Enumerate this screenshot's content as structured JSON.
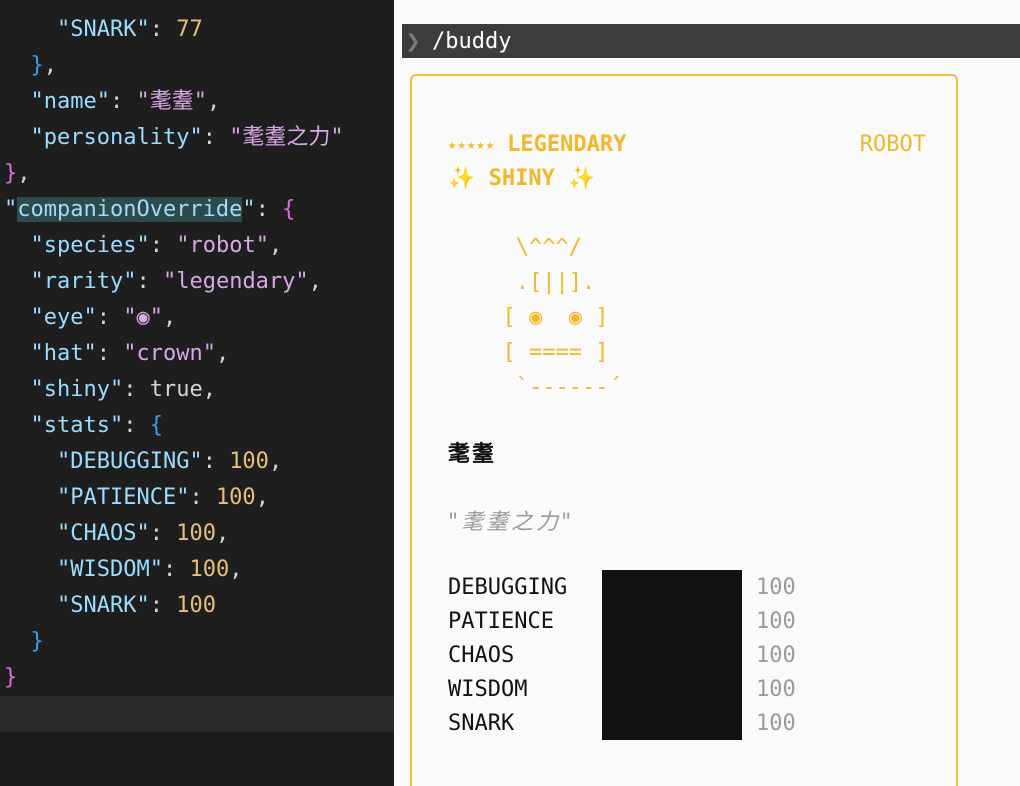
{
  "editor": {
    "lines": [
      {
        "indent": "    ",
        "tokens": [
          {
            "t": "\"SNARK\"",
            "c": "tok-key"
          },
          {
            "t": ": ",
            "c": "tok-punc"
          },
          {
            "t": "77",
            "c": "tok-num2"
          }
        ]
      },
      {
        "indent": "  ",
        "tokens": [
          {
            "t": "}",
            "c": "tok-brace-blue"
          },
          {
            "t": ",",
            "c": "tok-punc"
          }
        ]
      },
      {
        "indent": "  ",
        "tokens": [
          {
            "t": "\"name\"",
            "c": "tok-key"
          },
          {
            "t": ": ",
            "c": "tok-punc"
          },
          {
            "t": "\"耄耋\"",
            "c": "tok-strp"
          },
          {
            "t": ",",
            "c": "tok-punc"
          }
        ]
      },
      {
        "indent": "  ",
        "tokens": [
          {
            "t": "\"personality\"",
            "c": "tok-key"
          },
          {
            "t": ": ",
            "c": "tok-punc"
          },
          {
            "t": "\"耄耋之力\"",
            "c": "tok-strp"
          }
        ]
      },
      {
        "indent": "",
        "tokens": [
          {
            "t": "}",
            "c": "tok-brace-pink"
          },
          {
            "t": ",",
            "c": "tok-punc"
          }
        ]
      },
      {
        "indent": "",
        "tokens": [
          {
            "t": "\"",
            "c": "tok-key"
          },
          {
            "t": "companionOverride",
            "c": "tok-key tok-hl"
          },
          {
            "t": "\"",
            "c": "tok-key"
          },
          {
            "t": ": ",
            "c": "tok-punc"
          },
          {
            "t": "{",
            "c": "tok-brace-pink"
          }
        ]
      },
      {
        "indent": "  ",
        "tokens": [
          {
            "t": "\"species\"",
            "c": "tok-key"
          },
          {
            "t": ": ",
            "c": "tok-punc"
          },
          {
            "t": "\"robot\"",
            "c": "tok-strp"
          },
          {
            "t": ",",
            "c": "tok-punc"
          }
        ]
      },
      {
        "indent": "  ",
        "tokens": [
          {
            "t": "\"rarity\"",
            "c": "tok-key"
          },
          {
            "t": ": ",
            "c": "tok-punc"
          },
          {
            "t": "\"legendary\"",
            "c": "tok-strp"
          },
          {
            "t": ",",
            "c": "tok-punc"
          }
        ]
      },
      {
        "indent": "  ",
        "tokens": [
          {
            "t": "\"eye\"",
            "c": "tok-key"
          },
          {
            "t": ": ",
            "c": "tok-punc"
          },
          {
            "t": "\"◉\"",
            "c": "tok-strp"
          },
          {
            "t": ",",
            "c": "tok-punc"
          }
        ]
      },
      {
        "indent": "  ",
        "tokens": [
          {
            "t": "\"hat\"",
            "c": "tok-key"
          },
          {
            "t": ": ",
            "c": "tok-punc"
          },
          {
            "t": "\"crown\"",
            "c": "tok-strp"
          },
          {
            "t": ",",
            "c": "tok-punc"
          }
        ]
      },
      {
        "indent": "  ",
        "tokens": [
          {
            "t": "\"shiny\"",
            "c": "tok-key"
          },
          {
            "t": ": ",
            "c": "tok-punc"
          },
          {
            "t": "true",
            "c": "tok-bool"
          },
          {
            "t": ",",
            "c": "tok-punc"
          }
        ]
      },
      {
        "indent": "  ",
        "tokens": [
          {
            "t": "\"stats\"",
            "c": "tok-key"
          },
          {
            "t": ": ",
            "c": "tok-punc"
          },
          {
            "t": "{",
            "c": "tok-brace-blue"
          }
        ]
      },
      {
        "indent": "    ",
        "tokens": [
          {
            "t": "\"DEBUGGING\"",
            "c": "tok-key"
          },
          {
            "t": ": ",
            "c": "tok-punc"
          },
          {
            "t": "100",
            "c": "tok-num2"
          },
          {
            "t": ",",
            "c": "tok-punc"
          }
        ]
      },
      {
        "indent": "    ",
        "tokens": [
          {
            "t": "\"PATIENCE\"",
            "c": "tok-key"
          },
          {
            "t": ": ",
            "c": "tok-punc"
          },
          {
            "t": "100",
            "c": "tok-num2"
          },
          {
            "t": ",",
            "c": "tok-punc"
          }
        ]
      },
      {
        "indent": "    ",
        "tokens": [
          {
            "t": "\"CHAOS\"",
            "c": "tok-key"
          },
          {
            "t": ": ",
            "c": "tok-punc"
          },
          {
            "t": "100",
            "c": "tok-num2"
          },
          {
            "t": ",",
            "c": "tok-punc"
          }
        ]
      },
      {
        "indent": "    ",
        "tokens": [
          {
            "t": "\"WISDOM\"",
            "c": "tok-key"
          },
          {
            "t": ": ",
            "c": "tok-punc"
          },
          {
            "t": "100",
            "c": "tok-num2"
          },
          {
            "t": ",",
            "c": "tok-punc"
          }
        ]
      },
      {
        "indent": "    ",
        "tokens": [
          {
            "t": "\"SNARK\"",
            "c": "tok-key"
          },
          {
            "t": ": ",
            "c": "tok-punc"
          },
          {
            "t": "100",
            "c": "tok-num2"
          }
        ]
      },
      {
        "indent": "  ",
        "tokens": [
          {
            "t": "}",
            "c": "tok-brace-blue"
          }
        ]
      },
      {
        "indent": "",
        "tokens": [
          {
            "t": "}",
            "c": "tok-brace-pink"
          }
        ]
      }
    ]
  },
  "terminal": {
    "prompt_icon": "chevron-right-icon",
    "command": "/buddy"
  },
  "card": {
    "stars": "★★★★★",
    "rarity": "LEGENDARY",
    "species": "ROBOT",
    "sparkle_left": "✨",
    "shiny_label": "SHINY",
    "sparkle_right": "✨",
    "ascii_art": "   \\^^^/\n   .[||].\n  [ ◉  ◉ ]\n  [ ==== ]\n   `------´",
    "name": "耄耋",
    "quote": "\"耄耋之力\"",
    "stats": [
      {
        "label": "DEBUGGING",
        "value": "100",
        "fraction": 1.0
      },
      {
        "label": "PATIENCE",
        "value": "100",
        "fraction": 1.0
      },
      {
        "label": "CHAOS",
        "value": "100",
        "fraction": 1.0
      },
      {
        "label": "WISDOM",
        "value": "100",
        "fraction": 1.0
      },
      {
        "label": "SNARK",
        "value": "100",
        "fraction": 1.0
      }
    ],
    "accent_color": "#f0b82a",
    "border_color": "#f2bf3b"
  }
}
